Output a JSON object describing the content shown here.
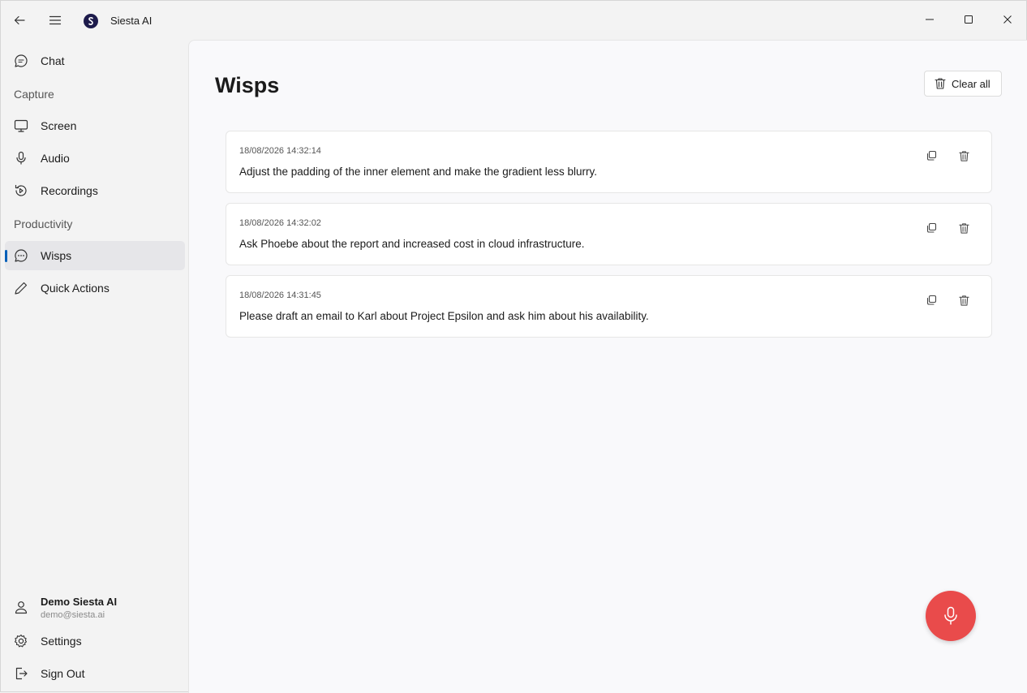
{
  "app": {
    "title": "Siesta AI"
  },
  "sidebar": {
    "items": [
      {
        "label": "Chat",
        "icon": "chat-icon"
      },
      {
        "label": "Screen",
        "icon": "monitor-icon"
      },
      {
        "label": "Audio",
        "icon": "microphone-icon"
      },
      {
        "label": "Recordings",
        "icon": "history-icon"
      },
      {
        "label": "Wisps",
        "icon": "speech-bubble-icon",
        "active": true
      },
      {
        "label": "Quick Actions",
        "icon": "pencil-icon"
      }
    ],
    "sections": {
      "capture": "Capture",
      "productivity": "Productivity"
    },
    "user": {
      "name": "Demo Siesta AI",
      "email": "demo@siesta.ai"
    },
    "settings_label": "Settings",
    "signout_label": "Sign Out"
  },
  "main": {
    "title": "Wisps",
    "clear_all_label": "Clear all",
    "wisps": [
      {
        "time": "18/08/2026 14:32:14",
        "text": "Adjust the padding of the inner element and make the gradient less blurry."
      },
      {
        "time": "18/08/2026 14:32:02",
        "text": "Ask Phoebe about the report and increased cost in cloud infrastructure."
      },
      {
        "time": "18/08/2026 14:31:45",
        "text": "Please draft an email to Karl about Project Epsilon and ask him about his availability."
      }
    ]
  },
  "colors": {
    "accent": "#005fb8",
    "mic_button": "#e94b4b",
    "logo": "#1d1b4b"
  }
}
